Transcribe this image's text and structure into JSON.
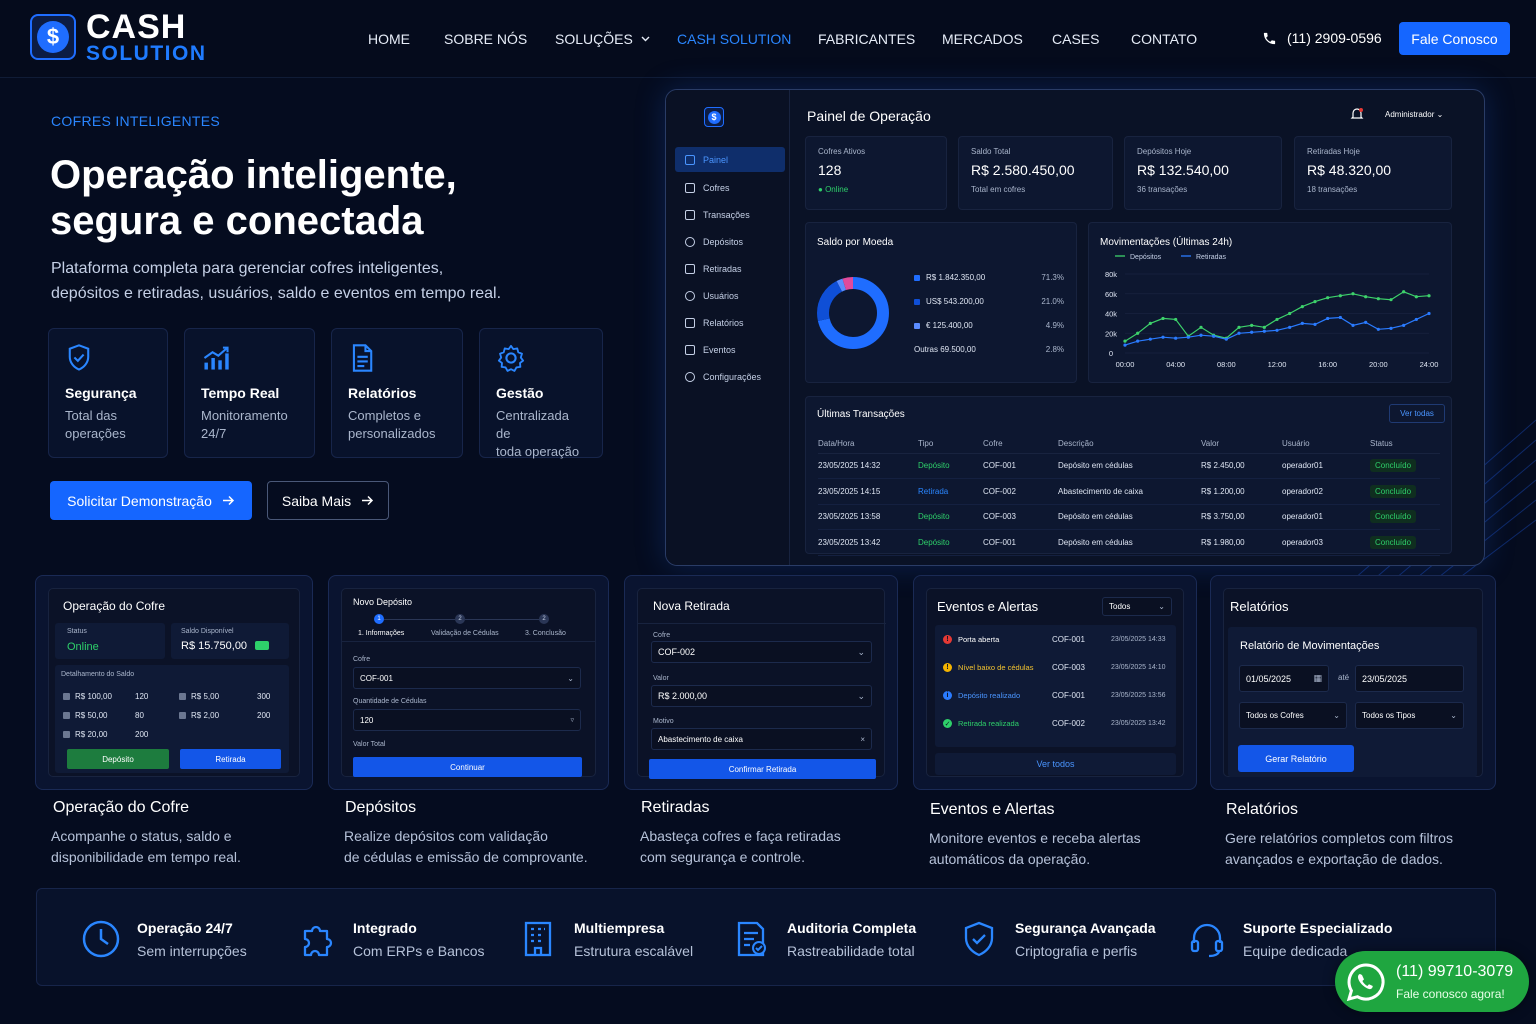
{
  "brand": {
    "line1": "CASH",
    "line2": "SOLUTION",
    "glyph": "$"
  },
  "nav": {
    "links": [
      "HOME",
      "SOBRE NÓS",
      "SOLUÇÕES",
      "CASH SOLUTION",
      "FABRICANTES",
      "MERCADOS",
      "CASES",
      "CONTATO"
    ],
    "active": "CASH SOLUTION",
    "phone": "(11) 2909-0596",
    "cta": "Fale Conosco"
  },
  "hero": {
    "eyebrow": "COFRES INTELIGENTES",
    "title_1": "Operação inteligente,",
    "title_2": "segura e conectada",
    "subtitle_1": "Plataforma completa para gerenciar cofres inteligentes,",
    "subtitle_2": "depósitos e retiradas, usuários, saldo e eventos em tempo real.",
    "features": [
      {
        "title": "Segurança",
        "desc_1": "Total das",
        "desc_2": "operações",
        "icon": "shield-check-icon"
      },
      {
        "title": "Tempo Real",
        "desc_1": "Monitoramento",
        "desc_2": "24/7",
        "icon": "chart-growth-icon"
      },
      {
        "title": "Relatórios",
        "desc_1": "Completos e",
        "desc_2": "personalizados",
        "icon": "document-icon"
      },
      {
        "title": "Gestão",
        "desc_1": "Centralizada de",
        "desc_2": "toda operação",
        "icon": "gear-icon"
      }
    ],
    "btn_primary": "Solicitar Demonstração",
    "btn_secondary": "Saiba Mais"
  },
  "dashboard": {
    "title": "Painel de Operação",
    "user": "Administrador",
    "sidebar": [
      "Painel",
      "Cofres",
      "Transações",
      "Depósitos",
      "Retiradas",
      "Usuários",
      "Relatórios",
      "Eventos",
      "Configurações"
    ],
    "kpis": [
      {
        "label": "Cofres Ativos",
        "value": "128",
        "sub": "Online"
      },
      {
        "label": "Saldo Total",
        "value": "R$ 2.580.450,00",
        "sub": "Total em cofres"
      },
      {
        "label": "Depósitos Hoje",
        "value": "R$ 132.540,00",
        "sub": "36 transações"
      },
      {
        "label": "Retiradas Hoje",
        "value": "R$ 48.320,00",
        "sub": "18 transações"
      }
    ],
    "donut": {
      "title": "Saldo por Moeda",
      "items": [
        {
          "label": "R$ 1.842.350,00",
          "pct": "71.3%",
          "value": 71.3,
          "color": "#1f6dff"
        },
        {
          "label": "US$ 543.200,00",
          "pct": "21.0%",
          "value": 21.0,
          "color": "#0f4fd6"
        },
        {
          "label": "€   125.400,00",
          "pct": "4.9%",
          "value": 4.9,
          "color": "#e04a9c"
        },
        {
          "label": "Outras   69.500,00",
          "pct": "2.8%",
          "value": 2.8,
          "color": "#5b8cff"
        }
      ]
    },
    "line_chart": {
      "title": "Movimentações (Últimas 24h)",
      "legend": [
        "Depósitos",
        "Retiradas"
      ],
      "x_ticks": [
        "00:00",
        "04:00",
        "08:00",
        "12:00",
        "16:00",
        "20:00",
        "24:00"
      ],
      "y_ticks": [
        "0",
        "20k",
        "40k",
        "60k",
        "80k"
      ]
    },
    "transactions": {
      "title": "Últimas Transações",
      "view_all": "Ver todas",
      "headers": [
        "Data/Hora",
        "Tipo",
        "Cofre",
        "Descrição",
        "Valor",
        "Usuário",
        "Status"
      ],
      "rows": [
        [
          "23/05/2025 14:32",
          "Depósito",
          "COF-001",
          "Depósito em cédulas",
          "R$ 2.450,00",
          "operador01",
          "Concluído"
        ],
        [
          "23/05/2025 14:15",
          "Retirada",
          "COF-002",
          "Abastecimento de caixa",
          "R$ 1.200,00",
          "operador02",
          "Concluído"
        ],
        [
          "23/05/2025 13:58",
          "Depósito",
          "COF-003",
          "Depósito em cédulas",
          "R$ 3.750,00",
          "operador01",
          "Concluído"
        ],
        [
          "23/05/2025 13:42",
          "Depósito",
          "COF-001",
          "Depósito em cédulas",
          "R$ 1.980,00",
          "operador03",
          "Concluído"
        ]
      ]
    }
  },
  "chart_data": {
    "type": "line",
    "title": "Movimentações (Últimas 24h)",
    "x": [
      "00:00",
      "01:00",
      "02:00",
      "03:00",
      "04:00",
      "05:00",
      "06:00",
      "07:00",
      "08:00",
      "09:00",
      "10:00",
      "11:00",
      "12:00",
      "13:00",
      "14:00",
      "15:00",
      "16:00",
      "17:00",
      "18:00",
      "19:00",
      "20:00",
      "21:00",
      "22:00",
      "23:00",
      "24:00"
    ],
    "ylim": [
      0,
      80000
    ],
    "series": [
      {
        "name": "Depósitos",
        "color": "#3dd26b",
        "values": [
          12000,
          20000,
          30000,
          35000,
          34000,
          17000,
          26000,
          18000,
          15000,
          26000,
          28000,
          26000,
          34000,
          40000,
          47000,
          52000,
          56000,
          58000,
          60000,
          57000,
          55000,
          54000,
          62000,
          57000,
          58000
        ]
      },
      {
        "name": "Retiradas",
        "color": "#2a7bff",
        "values": [
          8000,
          12000,
          14000,
          16000,
          15000,
          16000,
          18000,
          17000,
          14000,
          20000,
          21000,
          22000,
          23000,
          26000,
          30000,
          29000,
          35000,
          36000,
          28000,
          31000,
          24000,
          25000,
          28000,
          34000,
          40000
        ]
      }
    ],
    "grid": true,
    "legend": "top-left"
  },
  "modules": {
    "cofre": {
      "header": "Operação do Cofre",
      "status_label": "Status",
      "status_value": "Online",
      "saldo_label": "Saldo Disponível",
      "saldo_value": "R$ 15.750,00",
      "detail_title": "Detalhamento do Saldo",
      "rows_left": [
        [
          "R$ 100,00",
          "120"
        ],
        [
          "R$ 50,00",
          "80"
        ],
        [
          "R$ 20,00",
          "200"
        ]
      ],
      "rows_right": [
        [
          "R$   5,00",
          "300"
        ],
        [
          "R$   2,00",
          "200"
        ]
      ],
      "btn_dep": "Depósito",
      "btn_ret": "Retirada",
      "caption": "Operação do Cofre",
      "desc_1": "Acompanhe o status, saldo e",
      "desc_2": "disponibilidade em tempo real."
    },
    "deposito": {
      "header": "Novo Depósito",
      "steps": [
        "1. Informações",
        "Validação de Cédulas",
        "3. Conclusão"
      ],
      "step_nums": [
        "1",
        "2",
        "2"
      ],
      "cofre_label": "Cofre",
      "cofre_value": "COF-001",
      "qtd_label": "Quantidade de Cédulas",
      "qtd_value": "120",
      "total_label": "Valor Total",
      "btn": "Continuar",
      "caption": "Depósitos",
      "desc_1": "Realize depósitos com validação",
      "desc_2": "de cédulas e emissão de comprovante."
    },
    "retirada": {
      "header": "Nova Retirada",
      "cofre_label": "Cofre",
      "cofre_value": "COF-002",
      "valor_label": "Valor",
      "valor_value": "R$ 2.000,00",
      "motivo_label": "Motivo",
      "motivo_value": "Abastecimento de caixa",
      "btn": "Confirmar Retirada",
      "caption": "Retiradas",
      "desc_1": "Abasteça cofres e faça retiradas",
      "desc_2": "com segurança e controle."
    },
    "eventos": {
      "header": "Eventos e Alertas",
      "filter": "Todos",
      "rows": [
        {
          "label": "Porta aberta",
          "cofre": "COF-001",
          "time": "23/05/2025 14:33",
          "color": "#e53935",
          "label_color": "#ffffff",
          "glyph": "!"
        },
        {
          "label": "Nível baixo de cédulas",
          "cofre": "COF-003",
          "time": "23/05/2025 14:10",
          "color": "#f4b400",
          "label_color": "#f4c430",
          "glyph": "!"
        },
        {
          "label": "Depósito realizado",
          "cofre": "COF-001",
          "time": "23/05/2025 13:56",
          "color": "#2a7bff",
          "label_color": "#4a95ff",
          "glyph": "i"
        },
        {
          "label": "Retirada realizada",
          "cofre": "COF-002",
          "time": "23/05/2025 13:42",
          "color": "#2ed06a",
          "label_color": "#2ed06a",
          "glyph": "✓"
        }
      ],
      "view_all": "Ver todos",
      "caption": "Eventos e Alertas",
      "desc_1": "Monitore eventos e receba alertas",
      "desc_2": "automáticos da operação."
    },
    "relatorios": {
      "header": "Relatórios",
      "sub": "Relatório de Movimentações",
      "date_from": "01/05/2025",
      "until": "até",
      "date_to": "23/05/2025",
      "sel_cofres": "Todos os Cofres",
      "sel_tipos": "Todos os Tipos",
      "btn": "Gerar Relatório",
      "caption": "Relatórios",
      "desc_1": "Gere relatórios completos com filtros",
      "desc_2": "avançados e exportação de dados."
    }
  },
  "strip": [
    {
      "title": "Operação 24/7",
      "desc": "Sem interrupções",
      "icon": "clock-icon"
    },
    {
      "title": "Integrado",
      "desc": "Com ERPs e Bancos",
      "icon": "puzzle-icon"
    },
    {
      "title": "Multiempresa",
      "desc": "Estrutura escalável",
      "icon": "building-icon"
    },
    {
      "title": "Auditoria Completa",
      "desc": "Rastreabilidade total",
      "icon": "audit-document-icon"
    },
    {
      "title": "Segurança Avançada",
      "desc": "Criptografia e perfis",
      "icon": "shield-check-icon"
    },
    {
      "title": "Suporte Especializado",
      "desc": "Equipe dedicada",
      "icon": "headset-icon"
    }
  ],
  "whatsapp": {
    "number": "(11) 99710-3079",
    "sub": "Fale conosco agora!"
  },
  "colors": {
    "accent": "#1566ff",
    "bg": "#050c1f",
    "success": "#2ed06a",
    "whatsapp": "#1fa640"
  }
}
